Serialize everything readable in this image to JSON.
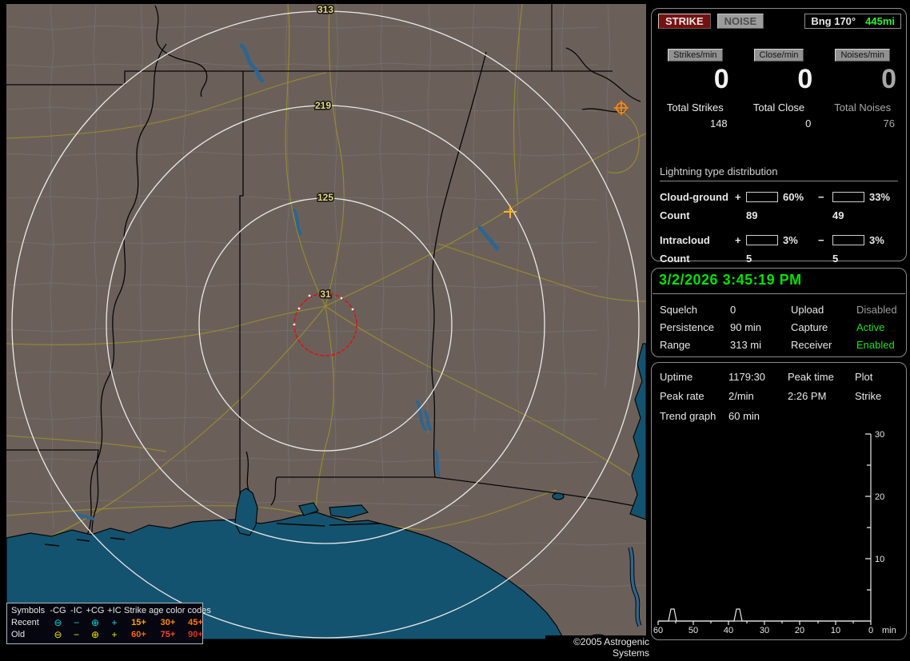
{
  "map": {
    "ring_labels": [
      "313",
      "219",
      "125",
      "31"
    ],
    "symbols_on_map": [
      {
        "name": "plus-cg-strike",
        "shape": "circle-plus",
        "color": "#ff8511"
      },
      {
        "name": "plus-ic-strike",
        "shape": "plus",
        "color": "#ffb030"
      }
    ],
    "legend": {
      "symbols_header": "Symbols",
      "type_headers": [
        "-CG",
        "-IC",
        "+CG",
        "+IC"
      ],
      "age_header": "Strike age color codes",
      "recent_label": "Recent",
      "old_label": "Old",
      "recent_color": "#00dede",
      "old_color": "#e8e800",
      "circle_minus": "⊖",
      "minus": "−",
      "circle_plus": "⊕",
      "plus": "+",
      "recent_ages": [
        {
          "text": "15+",
          "style": "color:#ffa200;font-weight:bold"
        },
        {
          "text": "30+",
          "style": "color:#ff8a00;font-weight:bold"
        },
        {
          "text": "45+",
          "style": "color:#ff7a00;font-weight:bold"
        }
      ],
      "old_ages": [
        {
          "text": "60+",
          "style": "color:#ff6600;font-weight:bold"
        },
        {
          "text": "75+",
          "style": "color:#ff4433;font-weight:bold"
        },
        {
          "text": "90+",
          "style": "color:#e03222;font-weight:bold"
        }
      ]
    },
    "copyright": "©2005 Astrogenic Systems"
  },
  "panel": {
    "strike_button": "STRIKE",
    "noise_button": "NOISE",
    "bearing": {
      "label": "Bng 170°",
      "value": "445mi",
      "value_color": "#33ee33"
    },
    "counters": [
      {
        "button": "Strikes/min",
        "rate": "0",
        "total_label": "Total Strikes",
        "total_value": "148"
      },
      {
        "button": "Close/min",
        "rate": "0",
        "total_label": "Total Close",
        "total_value": "0"
      },
      {
        "button": "Noises/min",
        "rate": "0",
        "total_label": "Total Noises",
        "total_value": "76"
      }
    ],
    "distribution": {
      "heading": "Lightning type distribution",
      "count_label": "Count",
      "rows": [
        {
          "label": "Cloud-ground",
          "plus_sign": "+",
          "plus_pct": "60%",
          "plus_fill": "width:60%;background:#ff1515",
          "minus_sign": "−",
          "minus_pct": "33%",
          "minus_fill": "width:33%;background:#9cccee",
          "plus_count": "89",
          "minus_count": "49"
        },
        {
          "label": "Intracloud",
          "plus_sign": "+",
          "plus_pct": "3%",
          "plus_fill": "width:7%;background:#ee6fc0",
          "minus_sign": "−",
          "minus_pct": "3%",
          "minus_fill": "width:7%;background:#44dd44",
          "plus_count": "5",
          "minus_count": "5"
        }
      ]
    },
    "clock": "3/2/2026 3:45:19 PM",
    "status": {
      "squelch_label": "Squelch",
      "squelch": "0",
      "persistence_label": "Persistence",
      "persistence": "90 min",
      "range_label": "Range",
      "range": "313 mi",
      "upload_label": "Upload",
      "upload": "Disabled",
      "capture_label": "Capture",
      "capture": "Active",
      "receiver_label": "Receiver",
      "receiver": "Enabled"
    },
    "info": {
      "uptime_label": "Uptime",
      "uptime": "1179:30",
      "peak_time_label": "Peak time",
      "plot_label": "Plot",
      "peak_rate_label": "Peak rate",
      "peak_rate": "2/min",
      "peak_time": "2:26 PM",
      "plot": "Strike",
      "trend_label": "Trend graph",
      "trend_value": "60 min"
    }
  },
  "chart_data": {
    "type": "line",
    "title": "Strike rate trend graph (last 60 min)",
    "xlabel": "min",
    "x_ticks": [
      "60",
      "50",
      "40",
      "30",
      "20",
      "10",
      "0"
    ],
    "y_ticks": [
      "10",
      "20",
      "30"
    ],
    "ylim": [
      0,
      30
    ],
    "xlim_minutes_ago": [
      60,
      0
    ],
    "series": [
      {
        "name": "Strike",
        "baseline": 0,
        "points": [
          {
            "minutes_ago": 56,
            "value": 2
          },
          {
            "minutes_ago": 38,
            "value": 2
          }
        ]
      }
    ]
  }
}
